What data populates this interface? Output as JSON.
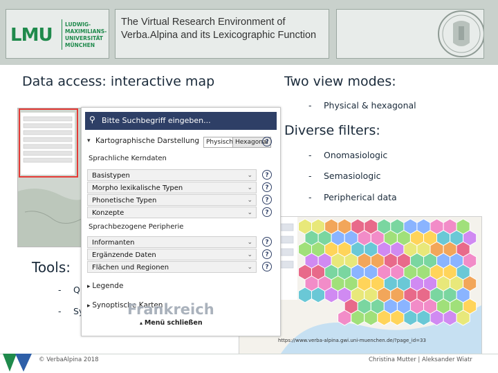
{
  "header": {
    "logo_main": "LMU",
    "logo_lines": [
      "LUDWIG-",
      "MAXIMILIANS-",
      "UNIVERSITÄT",
      "MÜNCHEN"
    ],
    "title": "The Virtual Research Environment of Verba.Alpina and its Lexicographic Function"
  },
  "left_heading": "Data access: interactive map",
  "right": {
    "view_heading": "Two view modes:",
    "view_items": [
      "Physical & hexagonal"
    ],
    "filter_heading": "Diverse filters:",
    "filter_items": [
      "Onomasiologic",
      "Semasiologic",
      "Peripherical data"
    ]
  },
  "tools": {
    "heading": "Tools:",
    "items": [
      "Qu",
      "Sy"
    ]
  },
  "panel": {
    "search_placeholder": "Bitte Suchbegriff eingeben...",
    "carto_label": "Kartographische Darstellung",
    "toggle_physical": "Physisch",
    "toggle_hex": "Hexagonal",
    "section1": "Sprachliche Kerndaten",
    "rows1": [
      "Basistypen",
      "Morpho lexikalische Typen",
      "Phonetische Typen",
      "Konzepte"
    ],
    "section2": "Sprachbezogene Peripherie",
    "rows2": [
      "Informanten",
      "Ergänzende Daten",
      "Flächen und Regionen"
    ],
    "legend": "Legende",
    "synoptic": "Synoptische Karten",
    "close": "Menü schließen",
    "overlay_map_word": "Frankreich",
    "help_glyph": "?",
    "chevron_glyph": "⌄"
  },
  "map": {
    "credit": "https://www.verba-alpina.gwi.uni-muenchen.de/?page_id=33",
    "colors": [
      "#e8e87a",
      "#f2a65a",
      "#e86a8a",
      "#7ad6a0",
      "#8ab4ff",
      "#f28cc8",
      "#a0e07a",
      "#ffd45a",
      "#6ac8d6",
      "#d08af2"
    ]
  },
  "footer": {
    "left": "© VerbaAlpina 2018",
    "right": "Christina Mutter | Aleksander Wiatr"
  },
  "colors": {
    "lmu_green": "#1f8a4c",
    "header_bg": "#c9d1cc",
    "panel_blue": "#2e3f66",
    "thumb_red": "#e53935"
  }
}
